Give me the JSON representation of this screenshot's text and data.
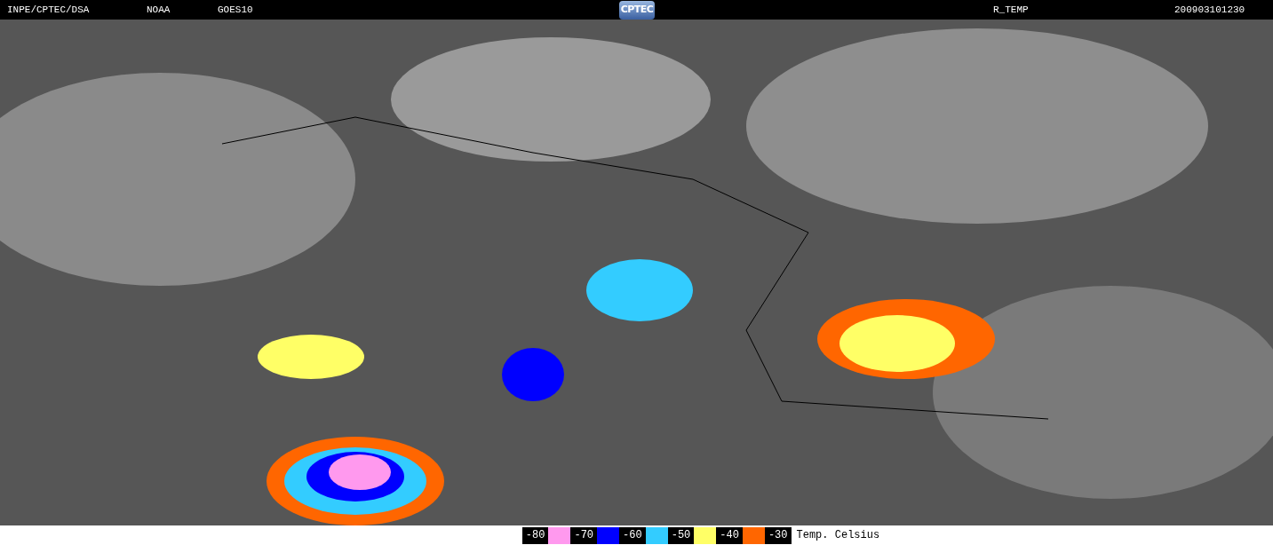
{
  "header": {
    "agency": "INPE/CPTEC/DSA",
    "source": "NOAA",
    "satellite": "GOES10",
    "logo": "CPTEC",
    "product": "R_TEMP",
    "timestamp": "200903101230"
  },
  "legend": {
    "items": [
      {
        "label": "-80",
        "color": "#ff99ee"
      },
      {
        "label": "-70",
        "color": "#0000ff"
      },
      {
        "label": "-60",
        "color": "#33ccff"
      },
      {
        "label": "-50",
        "color": "#ffff66"
      },
      {
        "label": "-40",
        "color": "#ff6600"
      },
      {
        "label": "-30"
      }
    ],
    "caption": "Temp. Celsius"
  }
}
